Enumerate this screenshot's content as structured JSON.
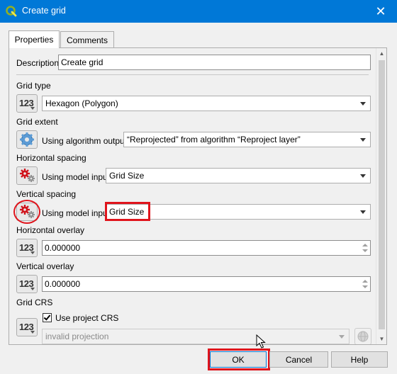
{
  "window": {
    "title": "Create grid",
    "close_glyph": "✕"
  },
  "tabs": [
    {
      "label": "Properties",
      "active": true
    },
    {
      "label": "Comments",
      "active": false
    }
  ],
  "description": {
    "label": "Description",
    "value": "Create grid"
  },
  "grid_type": {
    "label": "Grid type",
    "source_icon": "123",
    "value": "Hexagon (Polygon)"
  },
  "grid_extent": {
    "label": "Grid extent",
    "source_text": "Using algorithm output",
    "value": "“Reprojected” from algorithm “Reproject layer”"
  },
  "horizontal_spacing": {
    "label": "Horizontal spacing",
    "source_text": "Using model input",
    "value": "Grid Size"
  },
  "vertical_spacing": {
    "label": "Vertical spacing",
    "source_text": "Using model input",
    "value": "Grid Size"
  },
  "horizontal_overlay": {
    "label": "Horizontal overlay",
    "source_icon": "123",
    "value": "0.000000"
  },
  "vertical_overlay": {
    "label": "Vertical overlay",
    "source_icon": "123",
    "value": "0.000000"
  },
  "grid_crs": {
    "label": "Grid CRS",
    "source_icon": "123",
    "checkbox_label": "Use project CRS",
    "checked": true,
    "value": "invalid projection"
  },
  "buttons": {
    "ok": "OK",
    "cancel": "Cancel",
    "help": "Help"
  },
  "colors": {
    "titlebar": "#0078d7",
    "highlight": "#e0141c",
    "qgis_green": "#589632"
  }
}
